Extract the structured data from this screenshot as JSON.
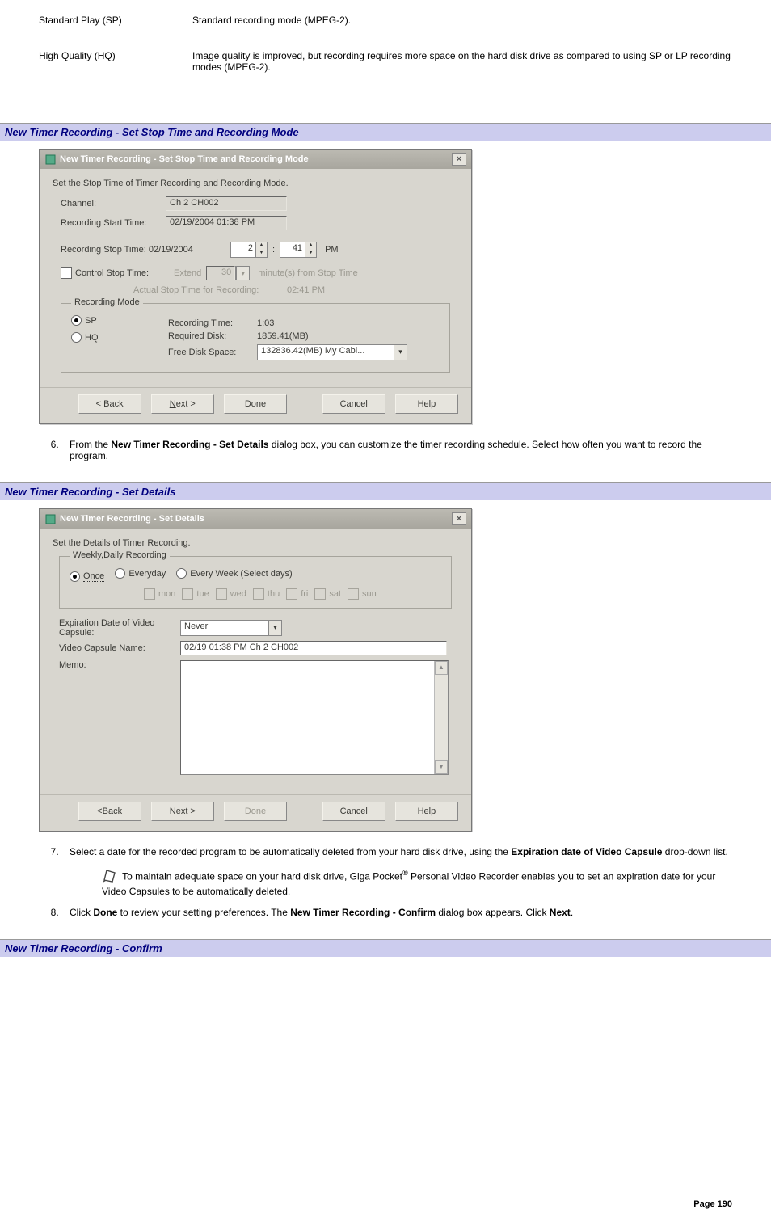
{
  "defs": {
    "sp_term": "Standard Play (SP)",
    "sp_desc": "Standard recording mode (MPEG-2).",
    "hq_term": "High Quality (HQ)",
    "hq_desc": "Image quality is improved, but recording requires more space on the hard disk drive as compared to using SP or LP recording modes (MPEG-2)."
  },
  "sections": {
    "h1": "New Timer Recording - Set Stop Time and Recording Mode",
    "h2": "New Timer Recording - Set Details",
    "h3": "New Timer Recording - Confirm"
  },
  "list": {
    "item6_a": "From the ",
    "item6_b": "New Timer Recording - Set Details",
    "item6_c": " dialog box, you can customize the timer recording schedule. Select how often you want to record the program.",
    "item7_a": "Select a date for the recorded program to be automatically deleted from your hard disk drive, using the ",
    "item7_b": "Expiration date of Video Capsule",
    "item7_c": " drop-down list.",
    "note7_a": " To maintain adequate space on your hard disk drive, Giga Pocket",
    "note7_reg": "®",
    "note7_b": " Personal Video Recorder enables you to set an expiration date for your Video Capsules to be automatically deleted.",
    "item8_a": "Click ",
    "item8_b": "Done",
    "item8_c": " to review your setting preferences. The ",
    "item8_d": "New Timer Recording - Confirm",
    "item8_e": " dialog box appears. Click ",
    "item8_f": "Next",
    "item8_g": "."
  },
  "dialog1": {
    "title": "New Timer Recording - Set Stop Time and Recording Mode",
    "subtitle": "Set the Stop Time of Timer Recording and Recording Mode.",
    "channel_label": "Channel:",
    "channel_value": "Ch 2 CH002",
    "start_label": "Recording Start Time:",
    "start_value": "02/19/2004 01:38 PM",
    "stop_label": "Recording Stop Time: 02/19/2004",
    "hour": "2",
    "colon": ":",
    "min": "41",
    "ampm": "PM",
    "ctrl_stop_label": "Control Stop Time:",
    "extend": "Extend",
    "extend_val": "30",
    "extend_tail": "minute(s) from Stop Time",
    "actual_label": "Actual Stop Time for Recording:",
    "actual_value": "02:41 PM",
    "recmode_legend": "Recording Mode",
    "sp": "SP",
    "hq": "HQ",
    "rectime_label": "Recording Time:",
    "rectime_value": "1:03",
    "reqdisk_label": "Required Disk:",
    "reqdisk_value": "1859.41(MB)",
    "freedisk_label": "Free Disk Space:",
    "freedisk_value": "132836.42(MB) My Cabi...",
    "btn_back": "< Back",
    "btn_next": "Next >",
    "btn_done": "Done",
    "btn_cancel": "Cancel",
    "btn_help": "Help"
  },
  "dialog2": {
    "title": "New Timer Recording - Set Details",
    "subtitle": "Set the Details of Timer Recording.",
    "wd_legend": "Weekly,Daily Recording",
    "once": "Once",
    "everyday": "Everyday",
    "everyweek": "Every Week (Select days)",
    "mon": "mon",
    "tue": "tue",
    "wed": "wed",
    "thu": "thu",
    "fri": "fri",
    "sat": "sat",
    "sun": "sun",
    "exp_label": "Expiration Date of Video Capsule:",
    "exp_value": "Never",
    "vcn_label": "Video Capsule Name:",
    "vcn_value": "02/19 01:38 PM Ch 2 CH002",
    "memo_label": "Memo:",
    "btn_back": "< Back",
    "btn_next": "Next >",
    "btn_done": "Done",
    "btn_cancel": "Cancel",
    "btn_help": "Help"
  },
  "footer": "Page 190"
}
